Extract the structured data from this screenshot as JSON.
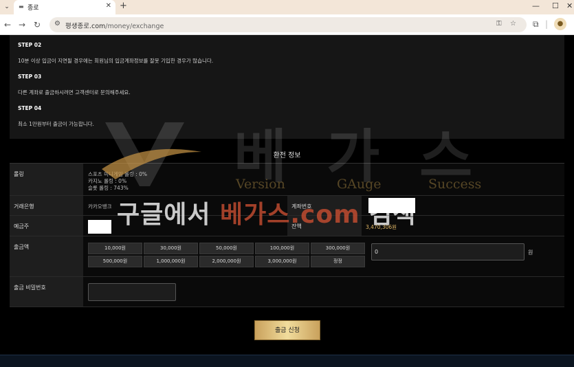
{
  "browser": {
    "tab_title": "종로",
    "url_host": "평생종로.com",
    "url_path": "/money/exchange"
  },
  "steps": [
    {
      "label": "STEP 02",
      "text": "10분 이상 입금이 지연될 경우에는 회원님의 입금계좌정보를 잘못 기입한 경우가 많습니다."
    },
    {
      "label": "STEP 03",
      "text": "다른 계좌로 출금하시려면 고객센터로 문의해주세요."
    },
    {
      "label": "STEP 04",
      "text": "최소 1만원부터 출금이 가능합니다."
    }
  ],
  "watermark": {
    "big": [
      "베",
      "가",
      "스"
    ],
    "sub": [
      "Version",
      "GAuge",
      "Success"
    ],
    "search_prefix": "구글에서 ",
    "search_brand": "베가스.com",
    "search_suffix": " 검색"
  },
  "section_title": "환전 정보",
  "form": {
    "rolling_label": "롤링",
    "rolling_lines": [
      "스포츠 미니게임 롤링 : 0%",
      "카지노 롤링 : 0%",
      "슬롯 롤링 : 743%"
    ],
    "bank_label": "거래은행",
    "bank_value": "카카오뱅크",
    "account_label": "계좌번호",
    "holder_label": "예금주",
    "balance_label": "잔액",
    "balance_value": "3,470,306원",
    "amount_label": "출금액",
    "amount_buttons": [
      "10,000원",
      "30,000원",
      "50,000원",
      "100,000원",
      "300,000원",
      "500,000원",
      "1,000,000원",
      "2,000,000원",
      "3,000,000원",
      "정정"
    ],
    "amount_value": "0",
    "amount_unit": "원",
    "password_label": "출금 비밀번호",
    "submit_label": "출금 신청"
  },
  "colors": {
    "accent_gold": "#e8c97e",
    "balance": "#e2b866"
  }
}
